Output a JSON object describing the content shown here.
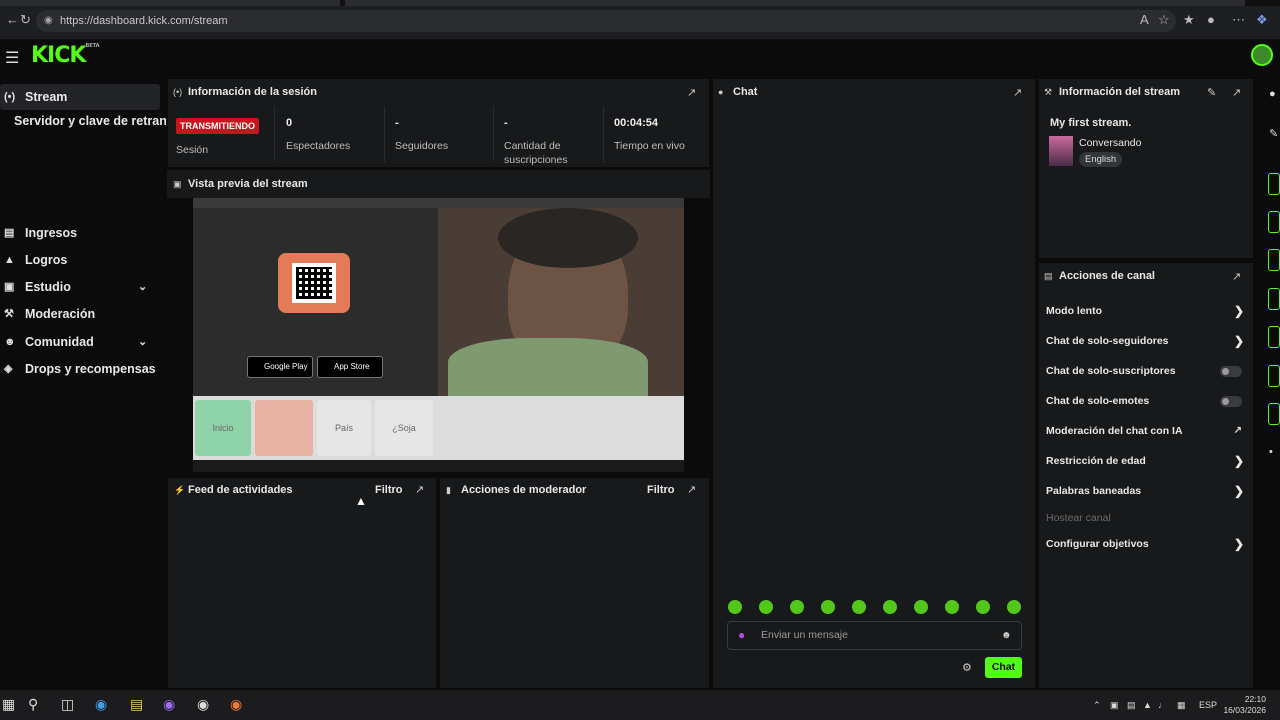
{
  "browser": {
    "url": "https://dashboard.kick.com/stream"
  },
  "header": {
    "logo": "KICK",
    "logo_badge": "BETA"
  },
  "sidebar": {
    "items": [
      {
        "label": "Stream",
        "icon": "broadcast-icon",
        "active": true
      },
      {
        "label": "Servidor y clave de retransmisión",
        "sub": true
      },
      {
        "label": "Ingresos",
        "icon": "chart-icon"
      },
      {
        "label": "Logros",
        "icon": "trophy-icon"
      },
      {
        "label": "Estudio",
        "icon": "camera-icon",
        "expandable": true
      },
      {
        "label": "Moderación",
        "icon": "wrench-icon"
      },
      {
        "label": "Comunidad",
        "icon": "people-icon",
        "expandable": true
      },
      {
        "label": "Drops y recompensas",
        "icon": "gift-icon"
      }
    ]
  },
  "session": {
    "title": "Información de la sesión",
    "status": "TRANSMITIENDO",
    "status_label": "Sesión",
    "stats": [
      {
        "value": "0",
        "label": "Espectadores"
      },
      {
        "value": "-",
        "label": "Seguidores"
      },
      {
        "value": "-",
        "label": "Cantidad de suscripciones"
      },
      {
        "value": "00:04:54",
        "label": "Tiempo en vivo"
      }
    ]
  },
  "preview": {
    "title": "Vista previa del stream",
    "google_play": "Google Play",
    "app_store": "App Store",
    "card_1": "Inicio",
    "card_2": "País",
    "card_3": "¿Soja"
  },
  "activity": {
    "title": "Feed de actividades",
    "filter": "Filtro"
  },
  "mod_actions": {
    "title": "Acciones de moderador",
    "filter": "Filtro"
  },
  "chat": {
    "title": "Chat",
    "placeholder": "Enviar un mensaje",
    "send_label": "Chat",
    "emote_count": 10
  },
  "stream_info": {
    "title": "Información del stream",
    "stream_title": "My first stream.",
    "category": "Conversando",
    "language": "English"
  },
  "channel_actions": {
    "title": "Acciones de canal",
    "rows": [
      {
        "label": "Modo lento",
        "kind": "arrow"
      },
      {
        "label": "Chat de solo-seguidores",
        "kind": "arrow"
      },
      {
        "label": "Chat de solo-suscriptores",
        "kind": "toggle"
      },
      {
        "label": "Chat de solo-emotes",
        "kind": "toggle"
      },
      {
        "label": "Moderación del chat con IA",
        "kind": "external"
      },
      {
        "label": "Restricción de edad",
        "kind": "arrow"
      },
      {
        "label": "Palabras baneadas",
        "kind": "arrow"
      },
      {
        "label": "Hostear canal",
        "kind": "disabled"
      },
      {
        "label": "Configurar objetivos",
        "kind": "arrow"
      }
    ]
  },
  "taskbar": {
    "lang": "ESP",
    "time": "22:10",
    "date": "16/03/2026"
  },
  "colors": {
    "accent": "#53fc18",
    "live": "#c8141c",
    "panel": "#18191b",
    "background": "#0b0b0c"
  }
}
